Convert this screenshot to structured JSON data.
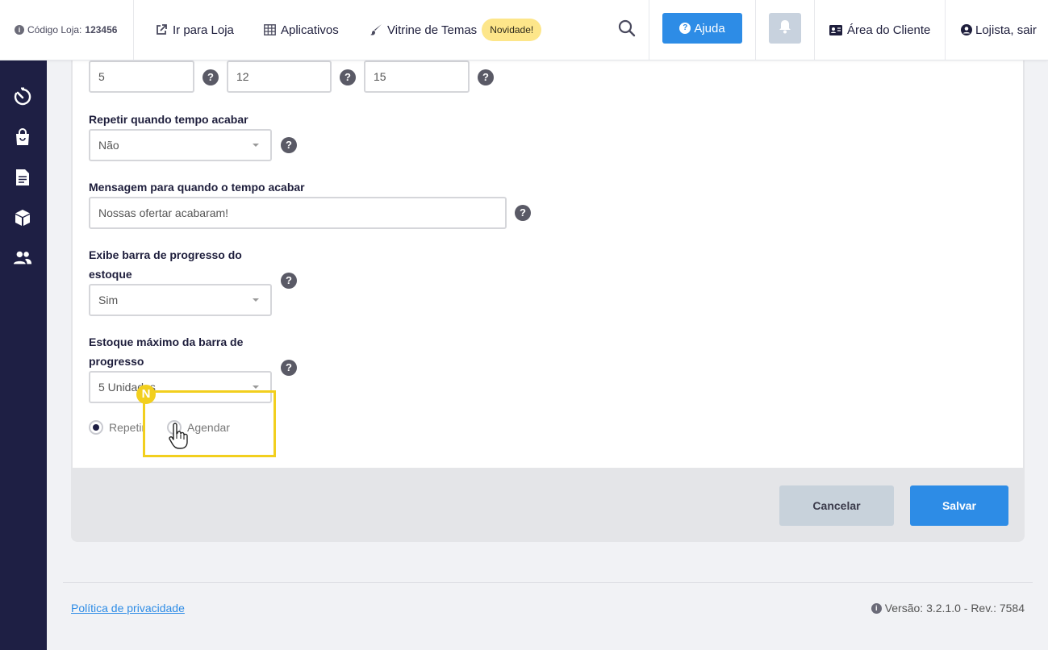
{
  "topbar": {
    "store_code_label": "Código Loja:",
    "store_code_value": "123456",
    "go_to_store": "Ir para Loja",
    "apps": "Aplicativos",
    "themes": "Vitrine de Temas",
    "new_badge": "Novidade!",
    "help": "Ajuda",
    "client_area": "Área do Cliente",
    "logout": "Lojista, sair"
  },
  "sidebar": {
    "icons": [
      "timer-icon",
      "shopping-bag-icon",
      "document-icon",
      "box-icon",
      "users-icon"
    ]
  },
  "form": {
    "time_inputs": [
      "5",
      "12",
      "15"
    ],
    "repeat_label": "Repetir quando tempo acabar",
    "repeat_value": "Não",
    "message_label": "Mensagem para quando o tempo acabar",
    "message_value": "Nossas ofertar acabaram!",
    "progress_label_line1": "Exibe barra de progresso do",
    "progress_label_line2": "estoque",
    "progress_value": "Sim",
    "max_stock_label_line1": "Estoque máximo da barra de",
    "max_stock_label_line2": "progresso",
    "max_stock_value": "5 Unidades",
    "radio_repeat": "Repetir",
    "radio_schedule": "Agendar",
    "help_mark": "?"
  },
  "actions": {
    "cancel": "Cancelar",
    "save": "Salvar"
  },
  "highlight": {
    "badge": "N"
  },
  "footer": {
    "privacy": "Política de privacidade",
    "version": "Versão: 3.2.1.0 - Rev.: 7584"
  },
  "colors": {
    "sidebar": "#1e1f44",
    "primary": "#2d8ce6",
    "highlight": "#f2cf1e",
    "badge_new": "#fde68a"
  }
}
